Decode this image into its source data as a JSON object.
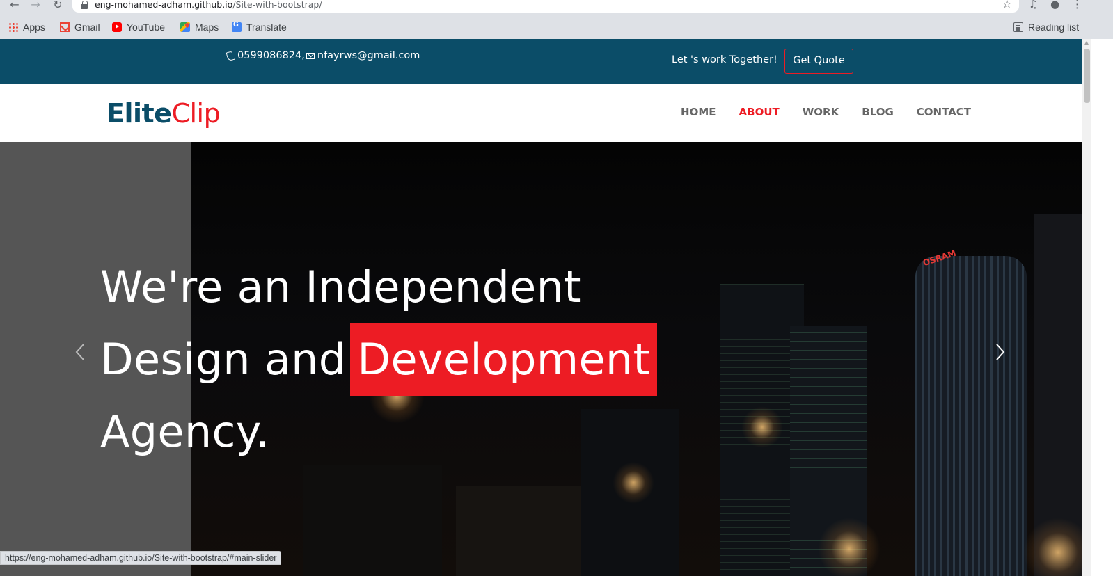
{
  "browser": {
    "url_host": "eng-mohamed-adham.github.io",
    "url_path": "/Site-with-bootstrap/",
    "bookmarks": [
      "Apps",
      "Gmail",
      "YouTube",
      "Maps",
      "Translate"
    ],
    "reading_list": "Reading list",
    "status_url": "https://eng-mohamed-adham.github.io/Site-with-bootstrap/#main-slider"
  },
  "topbar": {
    "phone": "0599086824,",
    "email": "nfayrws@gmail.com",
    "tagline": "Let 's work Together!",
    "quote_label": "Get Quote"
  },
  "logo": {
    "part1": "Elite",
    "part2": "Clip"
  },
  "nav": {
    "items": [
      "HOME",
      "ABOUT",
      "WORK",
      "BLOG",
      "CONTACT"
    ],
    "active": "ABOUT"
  },
  "hero": {
    "line1": "We're an Independent",
    "line2_prefix": "Design and",
    "line2_highlight": "Development",
    "line3": "Agency.",
    "sign_text": "OSRAM"
  },
  "colors": {
    "brand_dark": "#0b4d68",
    "brand_red": "#ed1c24"
  },
  "icons": [
    "back-icon",
    "forward-icon",
    "reload-icon",
    "lock-icon",
    "star-icon",
    "media-icon",
    "profile-icon",
    "menu-icon",
    "phone-icon",
    "mail-icon",
    "chevron-left-icon",
    "chevron-right-icon"
  ]
}
